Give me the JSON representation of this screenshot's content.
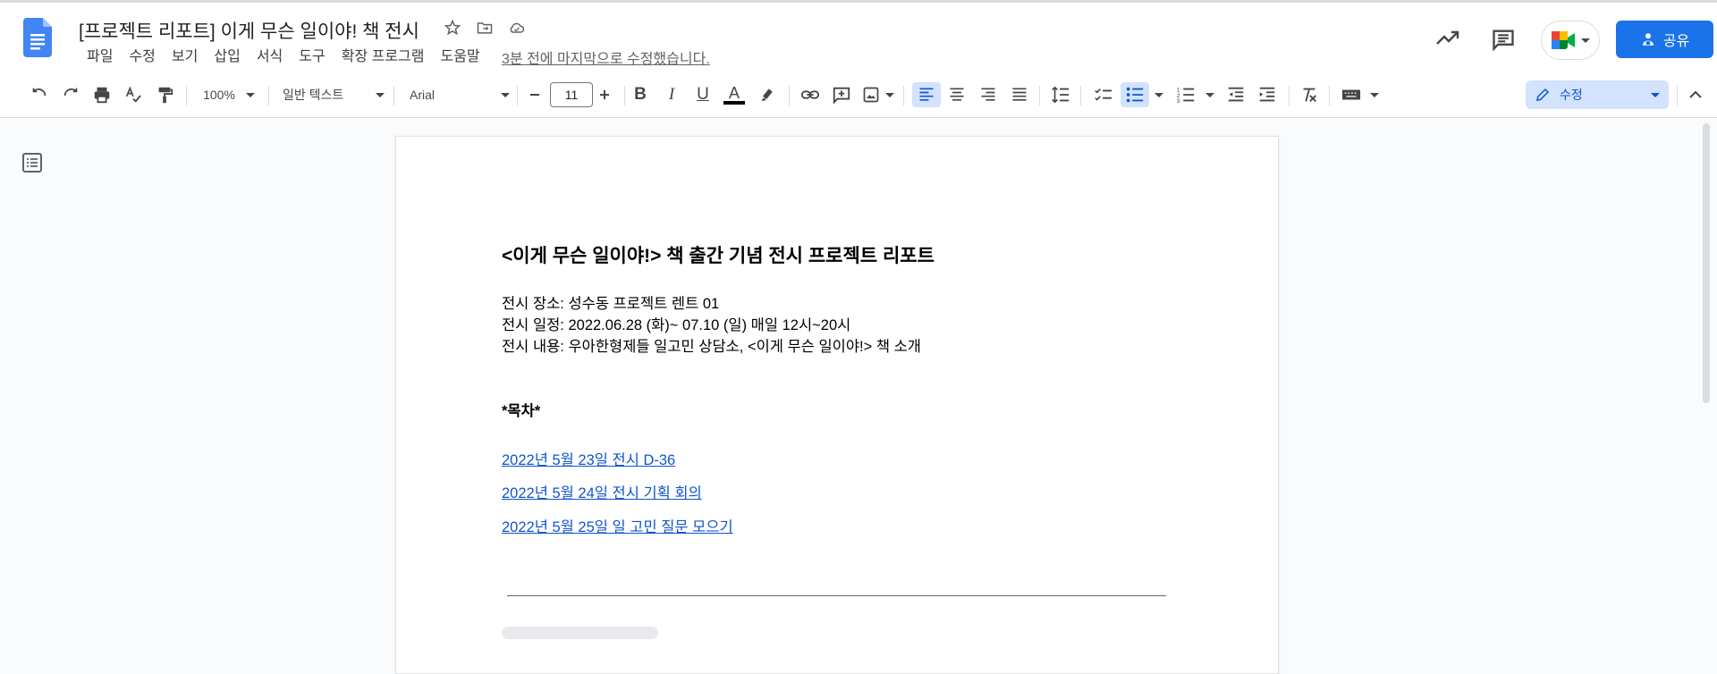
{
  "app": {
    "title": "[프로젝트 리포트] 이게 무슨 일이야! 책 전시",
    "last_edit": "3분 전에 마지막으로 수정했습니다."
  },
  "menu": [
    "파일",
    "수정",
    "보기",
    "삽입",
    "서식",
    "도구",
    "확장 프로그램",
    "도움말"
  ],
  "header_right": {
    "share_label": "공유"
  },
  "toolbar": {
    "zoom": "100%",
    "style": "일반 텍스트",
    "font": "Arial",
    "font_size": "11",
    "mode": "수정"
  },
  "document": {
    "heading": "<이게 무슨 일이야!> 책 출간 기념 전시 프로젝트 리포트",
    "lines": [
      "전시 장소: 성수동 프로젝트 렌트 01",
      "전시 일정: 2022.06.28 (화)~ 07.10 (일) 매일 12시~20시",
      "전시 내용: 우아한형제들 일고민 상담소, <이게 무슨 일이야!> 책 소개"
    ],
    "toc_title": "*목차*",
    "toc_links": [
      "2022년 5월 23일 전시 D-36",
      "2022년 5월 24일 전시 기획 회의",
      "2022년 5월 25일 일 고민 질문 모으기"
    ]
  },
  "colors": {
    "accent": "#1a73e8",
    "link": "#1155cc",
    "docs_blue": "#4285f4"
  }
}
